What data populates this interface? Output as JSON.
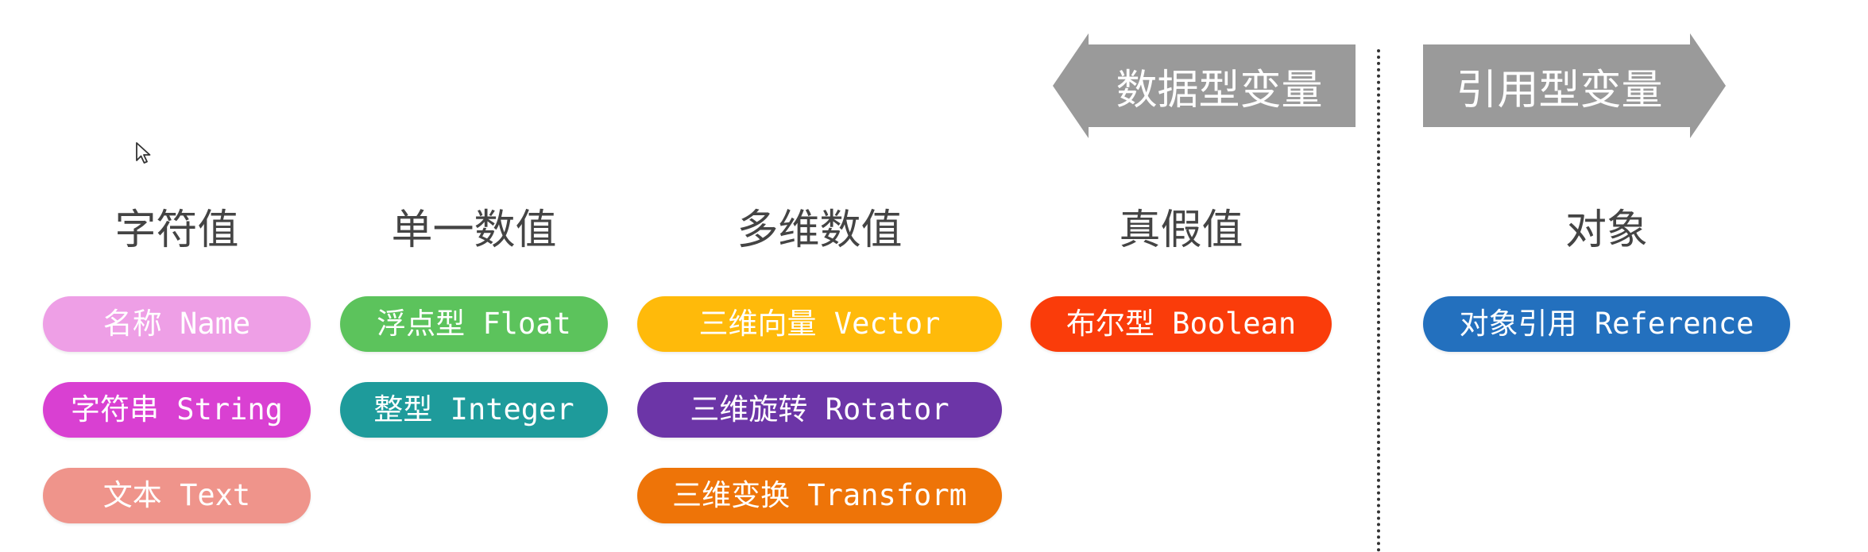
{
  "top_labels": {
    "data_variables": "数据型变量",
    "reference_variables": "引用型变量"
  },
  "columns": [
    {
      "title": "字符值",
      "items": [
        {
          "label": "名称 Name",
          "color": "#ee9fe6"
        },
        {
          "label": "字符串 String",
          "color": "#d940d2"
        },
        {
          "label": "文本 Text",
          "color": "#ef948b"
        }
      ]
    },
    {
      "title": "单一数值",
      "items": [
        {
          "label": "浮点型 Float",
          "color": "#5cc35c"
        },
        {
          "label": "整型 Integer",
          "color": "#1e9b9b"
        }
      ]
    },
    {
      "title": "多维数值",
      "items": [
        {
          "label": "三维向量 Vector",
          "color": "#ffba0a"
        },
        {
          "label": "三维旋转 Rotator",
          "color": "#6c35a7"
        },
        {
          "label": "三维变换 Transform",
          "color": "#ee7408"
        }
      ]
    },
    {
      "title": "真假值",
      "items": [
        {
          "label": "布尔型 Boolean",
          "color": "#fa3c0a"
        }
      ]
    },
    {
      "title": "对象",
      "items": [
        {
          "label": "对象引用 Reference",
          "color": "#2370be"
        }
      ]
    }
  ],
  "colors": {
    "arrow": "#9a9a9a",
    "heading": "#444444",
    "divider": "#333333"
  },
  "icons": [
    "mouse-cursor-icon"
  ]
}
